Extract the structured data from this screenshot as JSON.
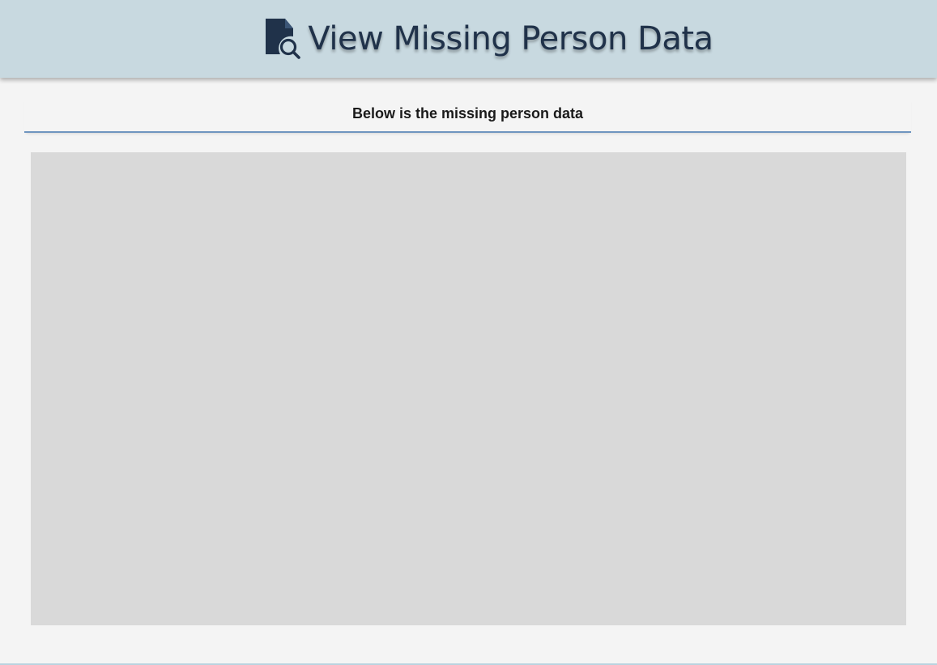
{
  "header": {
    "title": "View Missing Person Data",
    "icon": "document-search-icon",
    "icon_color": "#20324a",
    "background": "#c8d9e0"
  },
  "content": {
    "subtitle": "Below is the missing person data",
    "divider_color": "#6f95bf",
    "panel_color": "#d9d9d9"
  }
}
